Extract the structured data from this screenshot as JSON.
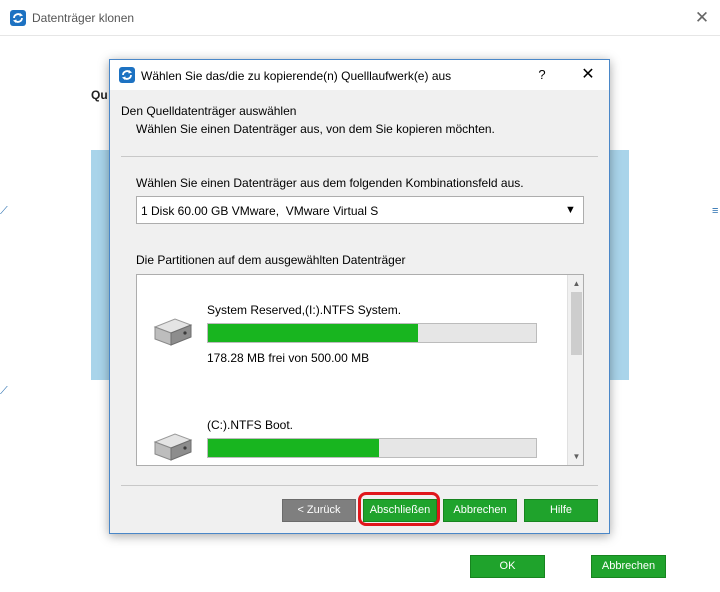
{
  "outer_window": {
    "title": "Datenträger klonen",
    "close_glyph": "✕",
    "heading": "Qu",
    "ok_label": "OK",
    "cancel_label": "Abbrechen"
  },
  "dialog": {
    "title": "Wählen Sie das/die zu kopierende(n) Quelllaufwerk(e) aus",
    "help_glyph": "?",
    "close_glyph": "✕",
    "section_title": "Den Quelldatenträger auswählen",
    "section_subtitle": "Wählen Sie einen Datenträger aus, von dem Sie kopieren möchten.",
    "combo_label": "Wählen Sie einen Datenträger aus dem folgenden Kombinationsfeld aus.",
    "combo_value": "1 Disk 60.00 GB VMware,  VMware Virtual S",
    "partitions_label": "Die Partitionen auf dem ausgewählten Datenträger",
    "partitions": [
      {
        "name": "System Reserved,(I:).NTFS System.",
        "free_text": "178.28 MB frei von 500.00 MB",
        "used_fraction": 0.64
      },
      {
        "name": "(C:).NTFS Boot.",
        "free_text": "",
        "used_fraction": 0.52
      }
    ],
    "buttons": {
      "back": "< Zurück",
      "finish": "Abschließen",
      "cancel": "Abbrechen",
      "help": "Hilfe"
    }
  },
  "colors": {
    "accent_green": "#1fa32c",
    "bar_green": "#18b51f",
    "highlight_red": "#e0161b",
    "dialog_border": "#4a87c8"
  },
  "icons": [
    "app-logo-icon",
    "close-icon",
    "help-icon",
    "dropdown-arrow-icon",
    "disk-drive-icon",
    "scroll-up-icon",
    "scroll-down-icon"
  ]
}
